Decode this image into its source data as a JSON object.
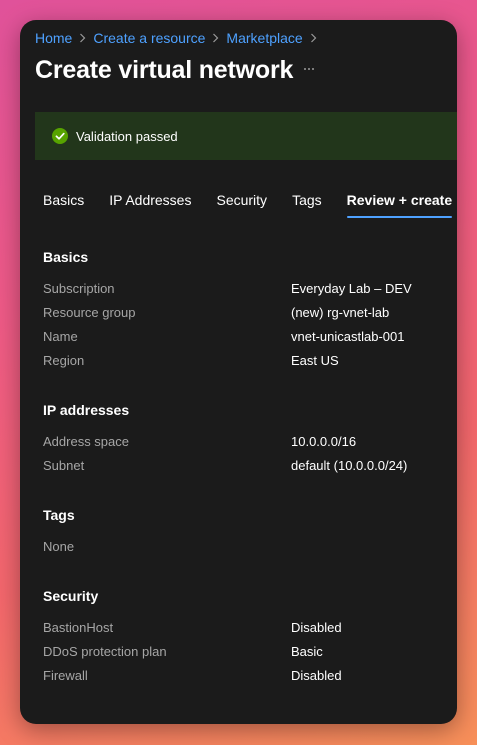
{
  "breadcrumb": [
    "Home",
    "Create a resource",
    "Marketplace"
  ],
  "title": "Create virtual network",
  "banner": {
    "text": "Validation passed",
    "color": "#22361b",
    "icon": "check-circle-icon"
  },
  "tabs": [
    {
      "label": "Basics",
      "active": false
    },
    {
      "label": "IP Addresses",
      "active": false
    },
    {
      "label": "Security",
      "active": false
    },
    {
      "label": "Tags",
      "active": false
    },
    {
      "label": "Review + create",
      "active": true
    }
  ],
  "sections": {
    "basics": {
      "title": "Basics",
      "rows": [
        {
          "label": "Subscription",
          "value": "Everyday Lab – DEV"
        },
        {
          "label": "Resource group",
          "value": "(new) rg-vnet-lab"
        },
        {
          "label": "Name",
          "value": "vnet-unicastlab-001"
        },
        {
          "label": "Region",
          "value": "East US"
        }
      ]
    },
    "ip": {
      "title": "IP addresses",
      "rows": [
        {
          "label": "Address space",
          "value": "10.0.0.0/16"
        },
        {
          "label": "Subnet",
          "value": "default (10.0.0.0/24)"
        }
      ]
    },
    "tags": {
      "title": "Tags",
      "none": "None"
    },
    "security": {
      "title": "Security",
      "rows": [
        {
          "label": "BastionHost",
          "value": "Disabled"
        },
        {
          "label": "DDoS protection plan",
          "value": "Basic"
        },
        {
          "label": "Firewall",
          "value": "Disabled"
        }
      ]
    }
  },
  "colors": {
    "accent": "#4ea1ff",
    "success": "#57a300",
    "window_bg": "#1b1b1b"
  }
}
